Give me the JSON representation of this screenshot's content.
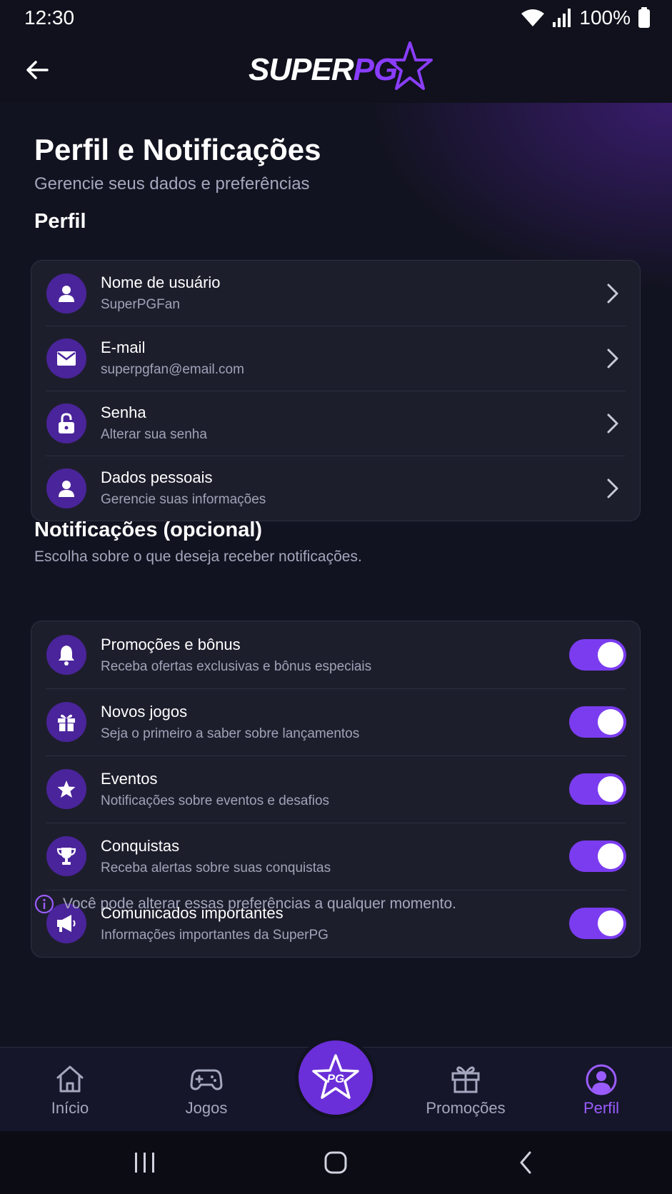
{
  "status_bar": {
    "time": "12:30",
    "battery": "100%"
  },
  "app": {
    "logo_super": "SUPER",
    "logo_pg": "PG"
  },
  "page": {
    "title": "Perfil e Notificações",
    "subtitle": "Gerencie seus dados e preferências"
  },
  "profile_section": {
    "title": "Perfil",
    "items": [
      {
        "title": "Nome de usuário",
        "subtitle": "SuperPGFan",
        "icon": "user-icon"
      },
      {
        "title": "E-mail",
        "subtitle": "superpgfan@email.com",
        "icon": "mail-icon"
      },
      {
        "title": "Senha",
        "subtitle": "Alterar sua senha",
        "icon": "lock-icon"
      },
      {
        "title": "Dados pessoais",
        "subtitle": "Gerencie suas informações",
        "icon": "user-icon"
      }
    ]
  },
  "notifications_section": {
    "title": "Notificações (opcional)",
    "description": "Escolha sobre o que deseja receber notificações.",
    "items": [
      {
        "title": "Promoções e bônus",
        "subtitle": "Receba ofertas exclusivas e bônus especiais",
        "icon": "bell-icon",
        "enabled": true
      },
      {
        "title": "Novos jogos",
        "subtitle": "Seja o primeiro a saber sobre lançamentos",
        "icon": "gift-icon",
        "enabled": true
      },
      {
        "title": "Eventos",
        "subtitle": "Notificações sobre eventos e desafios",
        "icon": "star-icon",
        "enabled": true
      },
      {
        "title": "Conquistas",
        "subtitle": "Receba alertas sobre suas conquistas",
        "icon": "trophy-icon",
        "enabled": true
      },
      {
        "title": "Comunicados importantes",
        "subtitle": "Informações importantes da SuperPG",
        "icon": "megaphone-icon",
        "enabled": true
      }
    ]
  },
  "info_note": "Você pode alterar essas preferências a qualquer momento.",
  "bottom_nav": {
    "items": [
      {
        "label": "Início",
        "icon": "home-icon"
      },
      {
        "label": "Jogos",
        "icon": "gamepad-icon"
      },
      {
        "label": "Promoções",
        "icon": "gift-icon"
      },
      {
        "label": "Perfil",
        "icon": "profile-icon",
        "active": true
      }
    ],
    "center_label": "PG"
  },
  "colors": {
    "accent": "#7b3cf0",
    "background": "#121320",
    "card": "#1d1e2c",
    "icon_bg": "#4a249a",
    "active_nav": "#9b5cff"
  }
}
